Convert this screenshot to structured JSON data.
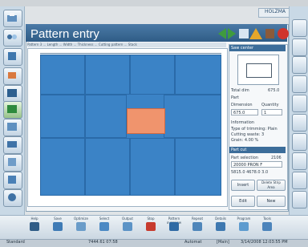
{
  "app": {
    "title": "Pattern entry",
    "brand": "HOLZMA"
  },
  "header_icons": [
    "arrow-left-icon",
    "arrow-right-icon",
    "zoom-icon",
    "warning-icon",
    "robot-icon",
    "stop-icon"
  ],
  "pattern": {
    "info_line": "Pattern 3 ... Length ... Width ... Thickness ... Cutting pattern ... Stack",
    "selected_part": "Part"
  },
  "right_panel": {
    "preview_header": "Saw center",
    "total_label": "Total dim",
    "total_value": "675.0",
    "part_label": "Part",
    "dimension_label": "Dimension",
    "quantity_label": "Quantity",
    "dimension_value": "675.0",
    "quantity_value": "1",
    "information_label": "Information",
    "info_rows": [
      "Type of trimming: Plain",
      "Cutting waste: 3",
      "Grain: 4.00 %"
    ],
    "part_section_header": "Part cut",
    "part_selection_label": "Part selection",
    "part_selection_value": "2106",
    "part_code": "20000 PRON F",
    "part_code2": "5815.0 4678.0 3.0",
    "insert_button": "Insert",
    "delete_button": "Delete Strip Area",
    "edit_button": "Edit",
    "new_button": "New"
  },
  "toolbar": {
    "items": [
      {
        "label": "Help",
        "icon": "help-icon",
        "color": "#2f5c86"
      },
      {
        "label": "Save",
        "icon": "save-icon",
        "color": "#3f7bb5"
      },
      {
        "label": "Optimize",
        "icon": "optimize-icon",
        "color": "#6a9cc9"
      },
      {
        "label": "Select",
        "icon": "select-icon",
        "color": "#4b89c4"
      },
      {
        "label": "Output",
        "icon": "output-icon",
        "color": "#5b93c6"
      },
      {
        "label": "Stop",
        "icon": "stop-icon",
        "color": "#c73b2e"
      },
      {
        "label": "Pattern overview",
        "icon": "pattern-overview-icon",
        "color": "#2f6aa4"
      },
      {
        "label": "Repeat",
        "icon": "repeat-icon",
        "color": "#4f86ba"
      },
      {
        "label": "Details",
        "icon": "details-icon",
        "color": "#3e78b0"
      },
      {
        "label": "Program",
        "icon": "program-icon",
        "color": "#5d9bcf"
      },
      {
        "label": "Tools",
        "icon": "tools-icon",
        "color": "#4c84bb"
      }
    ]
  },
  "status": {
    "mode": "Standard",
    "time": "7444.61 07:58",
    "mode2": "Automat",
    "state": "[Main]",
    "datetime": "3/14/2008 12:03:55 PM"
  },
  "left_rail": [
    "home-icon",
    "layout-icon",
    "book-icon",
    "cut-icon",
    "pattern-icon",
    "grid-icon",
    "list-icon",
    "print-icon",
    "brush-icon",
    "ruler-icon",
    "settings-icon",
    "panel-icon",
    "scan-icon"
  ],
  "right_rail": [
    "arrow-right-icon",
    "chart-icon",
    "stack-icon",
    "truck-icon",
    "print-icon",
    "user-icon",
    "tools-icon",
    "grid-icon",
    "list-icon",
    "info-icon",
    "scan-icon",
    "tool2-icon",
    "logout-icon"
  ]
}
